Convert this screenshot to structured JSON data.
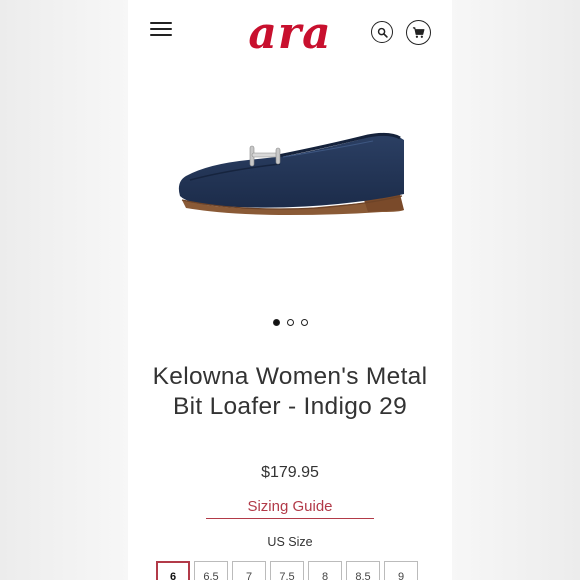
{
  "header": {
    "brand": "ara",
    "brand_color": "#c8102e",
    "icons": [
      "menu-icon",
      "search-icon",
      "cart-icon"
    ]
  },
  "carousel": {
    "image": "navy-suede-loafer",
    "slides": 3,
    "active_slide": 1
  },
  "product": {
    "title": "Kelowna Women's Metal Bit Loafer - Indigo 29",
    "price": "$179.95",
    "sizing_guide_label": "Sizing Guide",
    "size_label": "US Size",
    "sizes": [
      "6",
      "6.5",
      "7",
      "7.5",
      "8",
      "8.5",
      "9"
    ],
    "selected_size": "6"
  },
  "colors": {
    "accent": "#b23a48",
    "text": "#333333"
  }
}
